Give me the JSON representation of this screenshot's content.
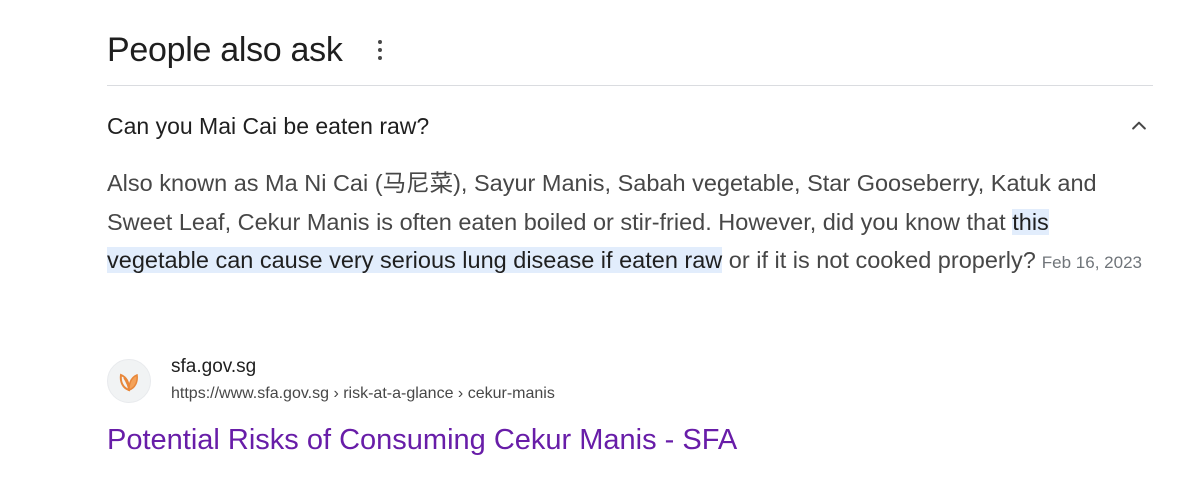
{
  "header": {
    "title": "People also ask",
    "more_icon": "more-vert-icon"
  },
  "question": {
    "text": "Can you Mai Cai be eaten raw?",
    "toggle_icon": "chevron-up-icon",
    "expanded": true
  },
  "answer": {
    "text_before": "Also known as Ma Ni Cai (马尼菜), Sayur Manis, Sabah vegetable, Star Gooseberry, Katuk and Sweet Leaf, Cekur Manis is often eaten boiled or stir-fried. However, did you know that ",
    "highlight": "this vegetable can cause very serious lung disease if eaten raw",
    "text_after": " or if it is not cooked properly?",
    "date": "Feb 16, 2023",
    "highlight_color": "#e2edfc"
  },
  "source": {
    "favicon": "sfa-leaf-logo-icon",
    "site_name": "sfa.gov.sg",
    "url": "https://www.sfa.gov.sg › risk-at-a-glance › cekur-manis"
  },
  "result": {
    "title": "Potential Risks of Consuming Cekur Manis - SFA",
    "link_color": "#681da8"
  }
}
